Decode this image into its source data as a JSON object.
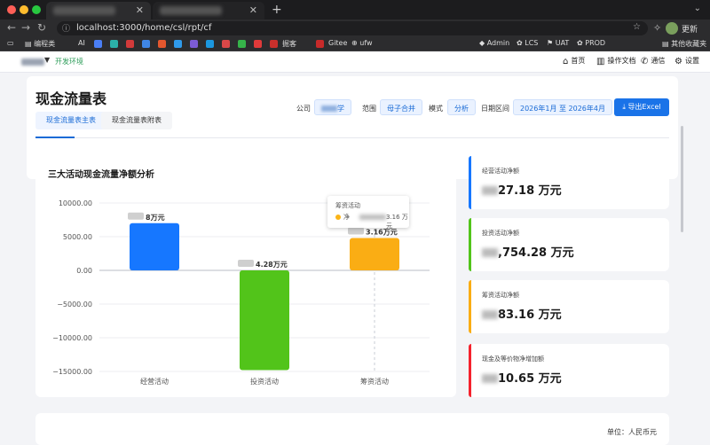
{
  "browser": {
    "url": "localhost:3000/home/csl/rpt/cf",
    "update_label": "更新",
    "bookmarks": [
      "编程类",
      "AI",
      "掘客",
      "Gitee",
      "ufw",
      "Admin",
      "LCS",
      "UAT",
      "PROD"
    ],
    "other_bookmarks": "其他收藏夹"
  },
  "header": {
    "env_label": "开发环境",
    "nav": {
      "home": "首页",
      "docs": "操作文档",
      "contacts": "通信",
      "settings": "设置"
    }
  },
  "page": {
    "title": "现金流量表",
    "tabs": [
      "现金流量表主表",
      "现金流量表附表"
    ],
    "filters": {
      "company_label": "公司",
      "company_value_suffix": "学",
      "scope_label": "范围",
      "scope_value": "母子合并",
      "mode_label": "模式",
      "mode_value": "分析",
      "date_label": "日期区间",
      "date_value": "2026年1月 至 2026年4月"
    },
    "export_label": "导出Excel",
    "export_icon": "download-icon",
    "unit": "单位：人民币元"
  },
  "stats": [
    {
      "label": "经营活动净额",
      "value_visible": "27.18 万元",
      "color": "#1677ff"
    },
    {
      "label": "投资活动净额",
      "value_visible": ",754.28 万元",
      "color": "#52c41a"
    },
    {
      "label": "筹资活动净额",
      "value_visible": "83.16 万元",
      "color": "#faad14"
    },
    {
      "label": "现金及等价物净增加额",
      "value_visible": "10.65 万元",
      "color": "#f5222d"
    }
  ],
  "chart_data": {
    "type": "bar",
    "title": "三大活动现金流量净额分析",
    "categories": [
      "经营活动",
      "投资活动",
      "筹资活动"
    ],
    "values": [
      7000,
      -14800,
      4800
    ],
    "data_labels": [
      "8万元",
      "4.28万元",
      "3.16万元"
    ],
    "colors": [
      "#1677ff",
      "#52c41a",
      "#faad14"
    ],
    "yticks": [
      10000,
      5000,
      0,
      -5000,
      -10000,
      -15000
    ],
    "ytick_labels": [
      "10000.00",
      "5000.00",
      "0.00",
      "−5000.00",
      "−10000.00",
      "−15000.00"
    ],
    "ylim": [
      -15000,
      10000
    ],
    "grid": true,
    "tooltip": {
      "title": "筹资活动",
      "series_label": "净",
      "value_suffix": "3.16 万元"
    }
  }
}
